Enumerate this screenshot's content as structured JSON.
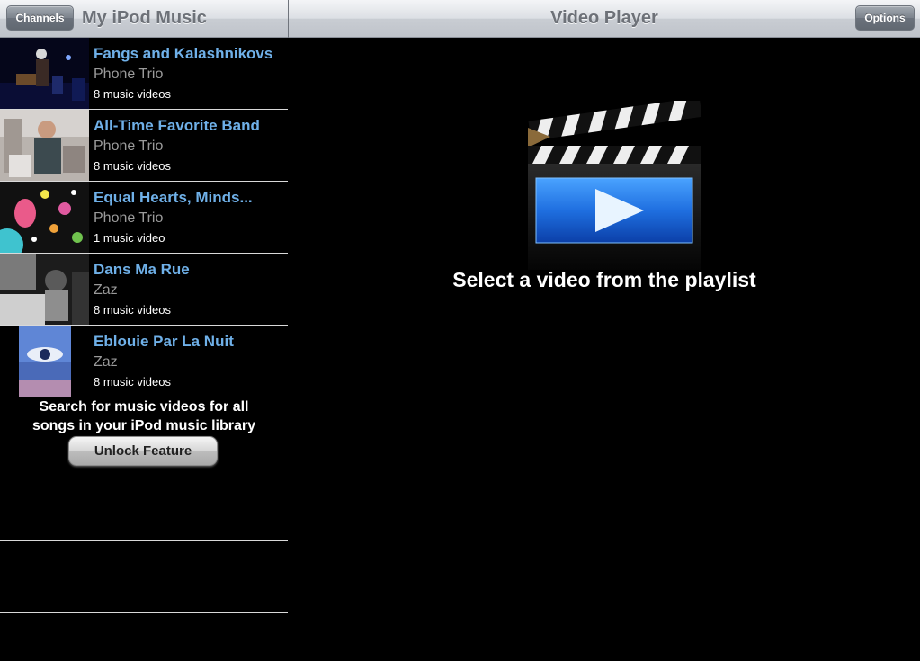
{
  "left_bar": {
    "channels_label": "Channels",
    "title": "My iPod Music"
  },
  "right_bar": {
    "title": "Video Player",
    "options_label": "Options"
  },
  "playlist": [
    {
      "title": "Fangs and Kalashnikovs",
      "artist": "Phone Trio",
      "count": "8 music videos"
    },
    {
      "title": "All-Time Favorite Band",
      "artist": "Phone Trio",
      "count": "8 music videos"
    },
    {
      "title": "Equal Hearts, Minds...",
      "artist": "Phone Trio",
      "count": "1 music video"
    },
    {
      "title": "Dans Ma Rue",
      "artist": "Zaz",
      "count": "8 music videos"
    },
    {
      "title": "Eblouie Par La Nuit",
      "artist": "Zaz",
      "count": "8 music videos"
    }
  ],
  "unlock": {
    "line1": "Search for music videos for all",
    "line2": "songs in your iPod music library",
    "button_label": "Unlock Feature"
  },
  "player": {
    "message": "Select a video from the playlist",
    "icon": "clapperboard-play-icon"
  },
  "colors": {
    "link_blue": "#6fb0e8",
    "artist_gray": "#9a9a9a",
    "background": "#000000"
  }
}
